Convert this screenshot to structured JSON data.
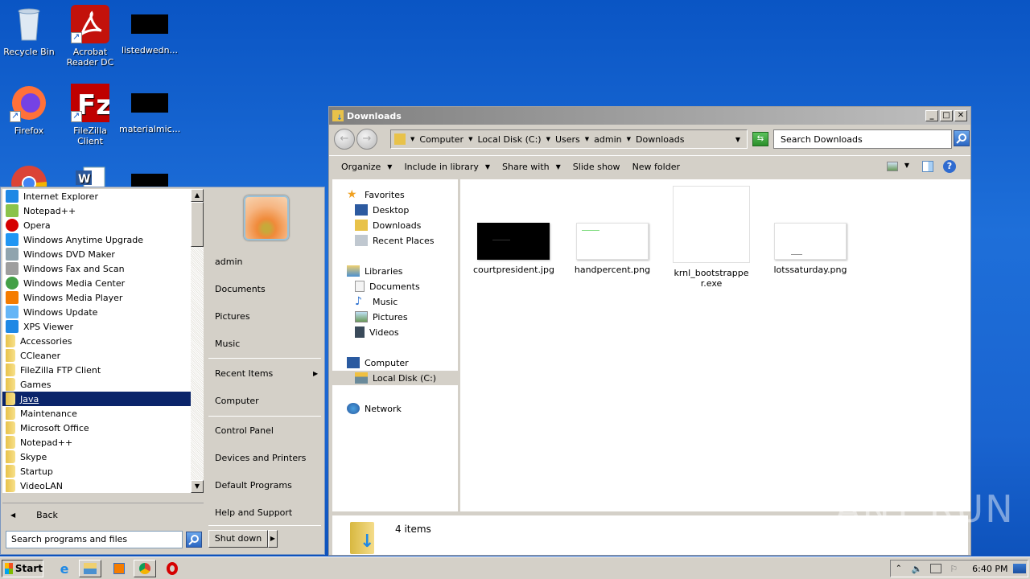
{
  "desktop": {
    "icons": [
      {
        "label": "Recycle Bin",
        "icon": "recycle-bin-icon"
      },
      {
        "label": "Acrobat Reader DC",
        "icon": "acrobat-icon"
      },
      {
        "label": "listedwedn...",
        "icon": "file-thumbnail-icon"
      },
      {
        "label": "Firefox",
        "icon": "firefox-icon"
      },
      {
        "label": "FileZilla Client",
        "icon": "filezilla-icon"
      },
      {
        "label": "materialmic...",
        "icon": "file-thumbnail-icon"
      }
    ]
  },
  "start_menu": {
    "programs": [
      {
        "label": "Internet Explorer",
        "icon": "ie-icon",
        "color": "#1e88e5"
      },
      {
        "label": "Notepad++",
        "icon": "notepadpp-icon",
        "color": "#8bc34a"
      },
      {
        "label": "Opera",
        "icon": "opera-icon",
        "color": "#d50000"
      },
      {
        "label": "Windows Anytime Upgrade",
        "icon": "windows-icon",
        "color": "#2196f3"
      },
      {
        "label": "Windows DVD Maker",
        "icon": "dvd-icon",
        "color": "#90a4ae"
      },
      {
        "label": "Windows Fax and Scan",
        "icon": "fax-icon",
        "color": "#9e9e9e"
      },
      {
        "label": "Windows Media Center",
        "icon": "media-center-icon",
        "color": "#43a047"
      },
      {
        "label": "Windows Media Player",
        "icon": "media-player-icon",
        "color": "#f57c00"
      },
      {
        "label": "Windows Update",
        "icon": "windows-update-icon",
        "color": "#64b5f6"
      },
      {
        "label": "XPS Viewer",
        "icon": "xps-icon",
        "color": "#1e88e5"
      },
      {
        "label": "Accessories",
        "icon": "folder-icon"
      },
      {
        "label": "CCleaner",
        "icon": "folder-icon"
      },
      {
        "label": "FileZilla FTP Client",
        "icon": "folder-icon"
      },
      {
        "label": "Games",
        "icon": "folder-icon"
      },
      {
        "label": "Java",
        "icon": "folder-icon",
        "selected": true
      },
      {
        "label": "Maintenance",
        "icon": "folder-icon"
      },
      {
        "label": "Microsoft Office",
        "icon": "folder-icon"
      },
      {
        "label": "Notepad++",
        "icon": "folder-icon"
      },
      {
        "label": "Skype",
        "icon": "folder-icon"
      },
      {
        "label": "Startup",
        "icon": "folder-icon"
      },
      {
        "label": "VideoLAN",
        "icon": "folder-icon"
      }
    ],
    "back_label": "Back",
    "search_placeholder": "Search programs and files",
    "right": {
      "user": "admin",
      "documents": "Documents",
      "pictures": "Pictures",
      "music": "Music",
      "recent_items": "Recent Items",
      "computer": "Computer",
      "control_panel": "Control Panel",
      "devices_printers": "Devices and Printers",
      "default_programs": "Default Programs",
      "help_support": "Help and Support"
    },
    "shutdown_label": "Shut down"
  },
  "explorer": {
    "title": "Downloads",
    "breadcrumb": [
      "Computer",
      "Local Disk (C:)",
      "Users",
      "admin",
      "Downloads"
    ],
    "search_placeholder": "Search Downloads",
    "toolbar": {
      "organize": "Organize",
      "include_library": "Include in library",
      "share_with": "Share with",
      "slide_show": "Slide show",
      "new_folder": "New folder"
    },
    "nav": {
      "favorites": "Favorites",
      "desktop": "Desktop",
      "downloads": "Downloads",
      "recent_places": "Recent Places",
      "libraries": "Libraries",
      "documents": "Documents",
      "music": "Music",
      "pictures": "Pictures",
      "videos": "Videos",
      "computer": "Computer",
      "local_disk": "Local Disk (C:)",
      "network": "Network"
    },
    "files": [
      {
        "name": "courtpresident.jpg",
        "type": "image"
      },
      {
        "name": "handpercent.png",
        "type": "image"
      },
      {
        "name": "krnl_bootstrapper.exe",
        "type": "executable"
      },
      {
        "name": "lotssaturday.png",
        "type": "image"
      }
    ],
    "status": "4 items"
  },
  "taskbar": {
    "start_label": "Start",
    "apps": [
      "Internet Explorer",
      "Windows Explorer",
      "Windows Media Player",
      "Google Chrome",
      "Opera"
    ],
    "clock": "6:40 PM"
  },
  "watermark": "ANY RUN"
}
